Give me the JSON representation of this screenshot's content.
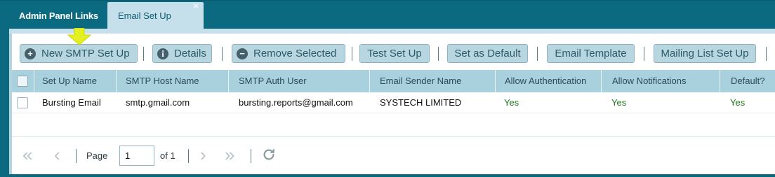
{
  "tabs": [
    {
      "label": "Admin Panel Links"
    },
    {
      "label": "Email Set Up",
      "close": "×"
    }
  ],
  "toolbar": {
    "new_label": "New SMTP Set Up",
    "details_label": "Details",
    "remove_label": "Remove Selected",
    "test_label": "Test Set Up",
    "default_label": "Set as Default",
    "template_label": "Email Template",
    "mailing_label": "Mailing List Set Up",
    "new_icon": "plus-circle-icon",
    "details_icon": "info-circle-icon",
    "remove_icon": "minus-circle-icon"
  },
  "grid": {
    "columns": [
      "Set Up Name",
      "SMTP Host Name",
      "SMTP Auth User",
      "Email Sender Name",
      "Allow Authentication",
      "Allow Notifications",
      "Default?"
    ],
    "rows": [
      {
        "setup_name": "Bursting Email",
        "smtp_host": "smtp.gmail.com",
        "auth_user": "bursting.reports@gmail.com",
        "sender_name": "SYSTECH LIMITED",
        "allow_auth": "Yes",
        "allow_notif": "Yes",
        "default": "Yes"
      }
    ]
  },
  "pager": {
    "page_label": "Page",
    "page_value": "1",
    "of_label": "of 1"
  },
  "colors": {
    "tab_bar": "#0c6a80",
    "active_tab": "#c5e0ea",
    "button": "#b7d6e0",
    "header_row": "#a9d0dd",
    "yes_text": "#1f7a1f",
    "pointer_arrow": "#e3f021"
  }
}
